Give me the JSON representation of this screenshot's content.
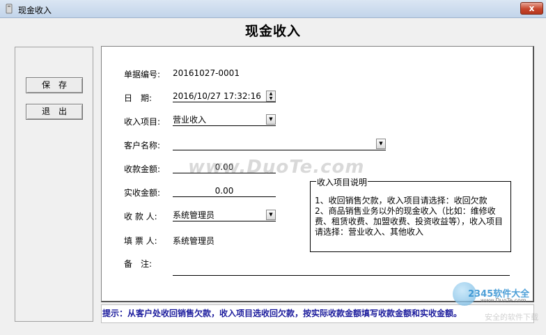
{
  "window": {
    "title": "现金收入",
    "close_symbol": "x"
  },
  "page": {
    "title": "现金收入"
  },
  "buttons": {
    "save": "保存",
    "exit": "退出"
  },
  "form": {
    "doc_no_label": "单据编号:",
    "doc_no_value": "20161027-0001",
    "date_label": "日　期:",
    "date_value": "2016/10/27 17:32:16",
    "item_label": "收入项目:",
    "item_value": "营业收入",
    "customer_label": "客户名称:",
    "customer_value": "",
    "receivable_label": "收款金额:",
    "receivable_value": "0.00",
    "received_label": "实收金额:",
    "received_value": "0.00",
    "payee_label": "收 款 人:",
    "payee_value": "系统管理员",
    "filler_label": "填 票 人:",
    "filler_value": "系统管理员",
    "remark_label": "备　注:",
    "remark_value": ""
  },
  "info": {
    "title": "收入项目说明",
    "line1": "1、收回销售欠款，收入项目请选择：收回欠款",
    "line2": "2、商品销售业务以外的现金收入（比如：维修收费、租赁收费、加盟收费、投资收益等），收入项目请选择：营业收入、其他收入"
  },
  "hint": "提示：从客户处收回销售欠款，收入项目选收回欠款，按实际收款金额填写收款金额和实收金额。",
  "watermarks": {
    "duote": "www.DuoTe.com",
    "logo_brand": "2345软件大全",
    "logo_url": "www.DuoTe.com",
    "logo_tagline": "安全的软件下载"
  },
  "icons": {
    "dropdown": "chevron-down-icon",
    "spinner": "spinner-icon",
    "close": "close-icon",
    "app": "app-icon"
  }
}
